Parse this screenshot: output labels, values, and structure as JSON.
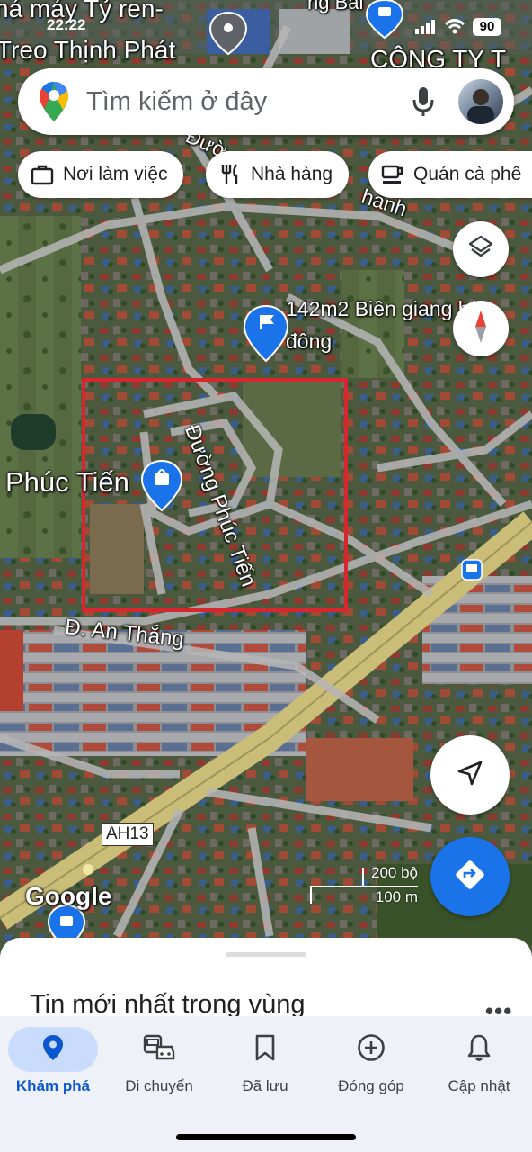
{
  "status_bar": {
    "time": "22:22",
    "battery": "90"
  },
  "search": {
    "placeholder": "Tìm kiếm ở đây"
  },
  "chips": [
    {
      "label": "Nơi làm việc",
      "icon": "briefcase-icon"
    },
    {
      "label": "Nhà hàng",
      "icon": "fork-knife-icon"
    },
    {
      "label": "Quán cà phê",
      "icon": "coffee-cup-icon"
    }
  ],
  "map": {
    "labels": {
      "top_left_1": "ná máy Tỷ ren-",
      "top_left_2": "Treo Thịnh Phát",
      "top_right": "CÔNG TY T",
      "top_mid": "ng Bài",
      "street_duong": "Đườ",
      "street_thanh": "hanh",
      "pin_142": "142m2 Biên giang hà",
      "pin_142_2": "đông",
      "phuc_tien": "Phúc Tiến",
      "duong_phuc_tien": "Đường Phúc Tiến",
      "an_thang": "Đ. An Thắng",
      "ah13": "AH13",
      "google": "Google"
    },
    "scale": {
      "feet": "200 bộ",
      "meters": "100 m"
    },
    "highlight_color": "#d6262e"
  },
  "sheet": {
    "title": "Tin mới nhất trong vùng",
    "more": "•••"
  },
  "nav": [
    {
      "label": "Khám phá",
      "icon": "location-pin-icon",
      "active": true
    },
    {
      "label": "Di chuyển",
      "icon": "commute-icon",
      "active": false
    },
    {
      "label": "Đã lưu",
      "icon": "bookmark-icon",
      "active": false
    },
    {
      "label": "Đóng góp",
      "icon": "add-circle-icon",
      "active": false
    },
    {
      "label": "Cập nhật",
      "icon": "bell-icon",
      "active": false
    }
  ],
  "colors": {
    "accent": "#1a73e8",
    "nav_active": "#0b57d0",
    "nav_bg": "#eef1f8"
  }
}
